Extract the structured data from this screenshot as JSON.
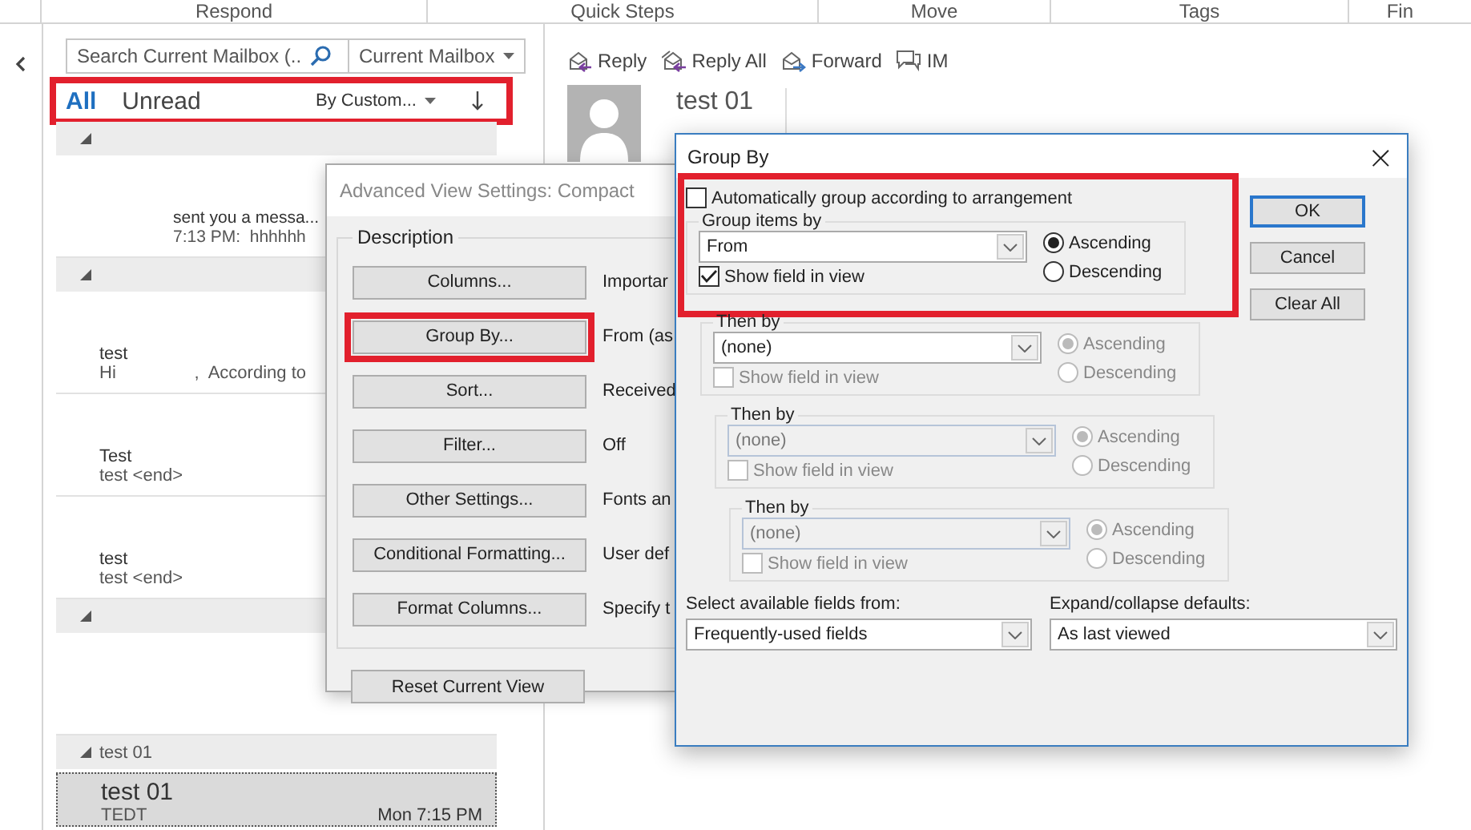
{
  "ribbon_groups": [
    "Respond",
    "Quick Steps",
    "Move",
    "Tags",
    "Fin"
  ],
  "mail_list": {
    "search": {
      "placeholder": "Search Current Mailbox (..."
    },
    "scope": "Current Mailbox",
    "filters": [
      {
        "label": "All",
        "selected": true
      },
      {
        "label": "Unread",
        "selected": false
      }
    ],
    "arrange": "By Custom...",
    "highlighted": true,
    "items": [
      {
        "kind": "group",
        "expanded": true
      },
      {
        "kind": "message",
        "selected": false,
        "title": "sent you a messa...",
        "preview": "7:13 PM:  hhhhhh",
        "indented": true
      },
      {
        "kind": "group",
        "expanded": true
      },
      {
        "kind": "message",
        "selected": false,
        "title": "test",
        "preview": "Hi                ,  According to"
      },
      {
        "kind": "message",
        "selected": false,
        "title": "Test",
        "preview": "test <end>"
      },
      {
        "kind": "message",
        "selected": false,
        "title": "test",
        "preview": "test <end>"
      },
      {
        "kind": "group",
        "expanded": true
      },
      {
        "kind": "message",
        "selected": false
      },
      {
        "kind": "group",
        "expanded": true,
        "label": "test 01"
      },
      {
        "kind": "message",
        "selected": true,
        "title": "test 01",
        "preview": "TEDT",
        "time": "Mon 7:15 PM"
      }
    ]
  },
  "reading_pane": {
    "actions": [
      {
        "label": "Reply"
      },
      {
        "label": "Reply All"
      },
      {
        "label": "Forward"
      },
      {
        "label": "IM"
      }
    ],
    "subject": "test 01"
  },
  "advanced_dialog": {
    "title": "Advanced View Settings: Compact",
    "section": "Description",
    "rows": [
      {
        "button": "Columns...",
        "value": "Importar",
        "highlighted": false
      },
      {
        "button": "Group By...",
        "value": "From (as",
        "highlighted": true
      },
      {
        "button": "Sort...",
        "value": "Received",
        "highlighted": false
      },
      {
        "button": "Filter...",
        "value": "Off",
        "highlighted": false
      },
      {
        "button": "Other Settings...",
        "value": "Fonts an",
        "highlighted": false
      },
      {
        "button": "Conditional Formatting...",
        "value": "User def",
        "highlighted": false
      },
      {
        "button": "Format Columns...",
        "value": "Specify t",
        "highlighted": false
      }
    ],
    "reset": "Reset Current View"
  },
  "group_by_dialog": {
    "title": "Group By",
    "close": "×",
    "auto_group": {
      "label": "Automatically group according to arrangement",
      "checked": false
    },
    "highlighted": true,
    "levels": [
      {
        "legend": "Group items by",
        "field": "From",
        "enabled": true,
        "show_field": {
          "label": "Show field in view",
          "checked": true,
          "disabled": false
        },
        "order": [
          {
            "label": "Ascending",
            "selected": true,
            "disabled": false
          },
          {
            "label": "Descending",
            "selected": false,
            "disabled": false
          }
        ]
      },
      {
        "legend": "Then by",
        "field": "(none)",
        "enabled": true,
        "show_field": {
          "label": "Show field in view",
          "checked": false,
          "disabled": true
        },
        "order": [
          {
            "label": "Ascending",
            "selected": true,
            "disabled": true
          },
          {
            "label": "Descending",
            "selected": false,
            "disabled": true
          }
        ]
      },
      {
        "legend": "Then by",
        "field": "(none)",
        "enabled": false,
        "show_field": {
          "label": "Show field in view",
          "checked": false,
          "disabled": true
        },
        "order": [
          {
            "label": "Ascending",
            "selected": true,
            "disabled": true
          },
          {
            "label": "Descending",
            "selected": false,
            "disabled": true
          }
        ]
      },
      {
        "legend": "Then by",
        "field": "(none)",
        "enabled": false,
        "show_field": {
          "label": "Show field in view",
          "checked": false,
          "disabled": true
        },
        "order": [
          {
            "label": "Ascending",
            "selected": true,
            "disabled": true
          },
          {
            "label": "Descending",
            "selected": false,
            "disabled": true
          }
        ]
      }
    ],
    "buttons": [
      {
        "label": "OK",
        "default": true
      },
      {
        "label": "Cancel",
        "default": false
      },
      {
        "label": "Clear All",
        "default": false
      }
    ],
    "available_fields": {
      "label": "Select available fields from:",
      "value": "Frequently-used fields"
    },
    "expand_defaults": {
      "label": "Expand/collapse defaults:",
      "value": "As last viewed"
    }
  }
}
